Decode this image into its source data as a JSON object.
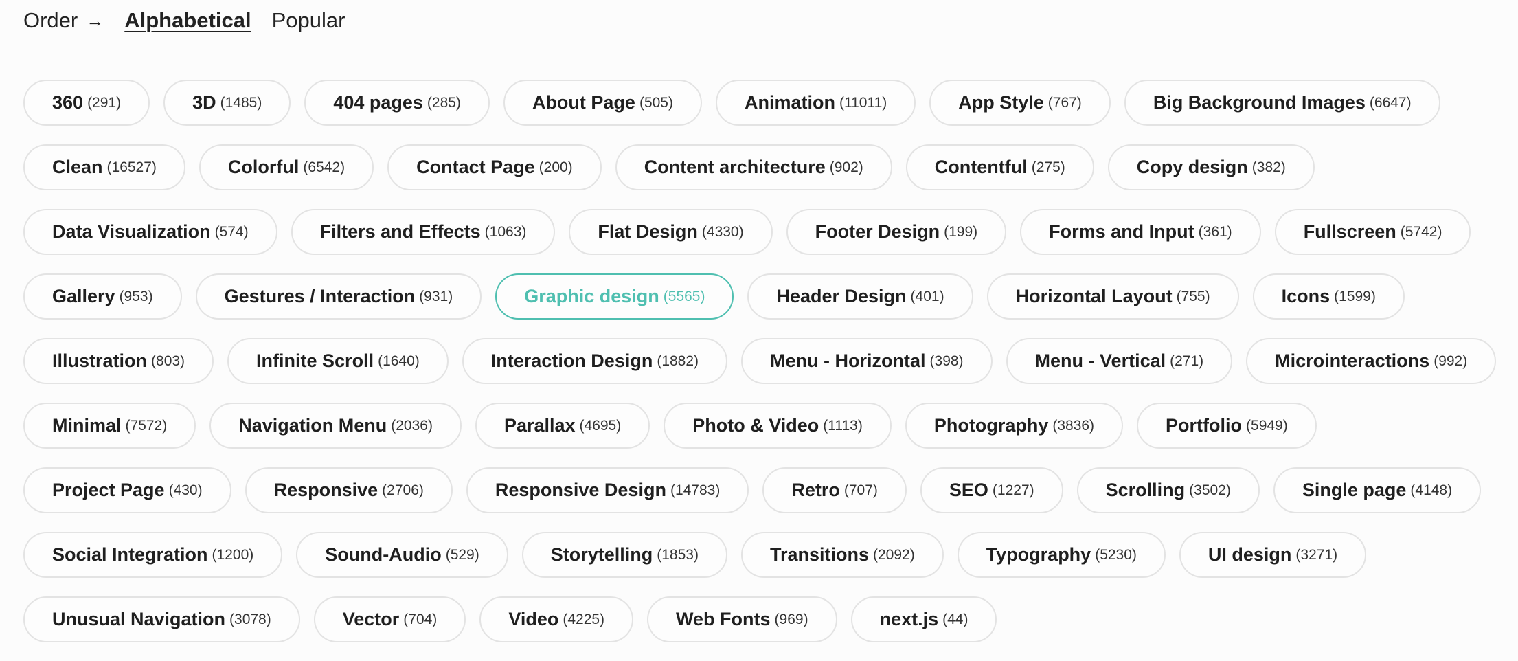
{
  "order": {
    "label": "Order",
    "arrow": "→",
    "options": [
      {
        "label": "Alphabetical",
        "active": true
      },
      {
        "label": "Popular",
        "active": false
      }
    ]
  },
  "accent_color": "#4fbfb0",
  "tags": [
    {
      "name": "360",
      "count": "(291)"
    },
    {
      "name": "3D",
      "count": "(1485)"
    },
    {
      "name": "404 pages",
      "count": "(285)"
    },
    {
      "name": "About Page",
      "count": "(505)"
    },
    {
      "name": "Animation",
      "count": "(11011)"
    },
    {
      "name": "App Style",
      "count": "(767)"
    },
    {
      "name": "Big Background Images",
      "count": "(6647)"
    },
    {
      "name": "Clean",
      "count": "(16527)"
    },
    {
      "name": "Colorful",
      "count": "(6542)"
    },
    {
      "name": "Contact Page",
      "count": "(200)"
    },
    {
      "name": "Content architecture",
      "count": "(902)"
    },
    {
      "name": "Contentful",
      "count": "(275)"
    },
    {
      "name": "Copy design",
      "count": "(382)"
    },
    {
      "name": "Data Visualization",
      "count": "(574)"
    },
    {
      "name": "Filters and Effects",
      "count": "(1063)"
    },
    {
      "name": "Flat Design",
      "count": "(4330)"
    },
    {
      "name": "Footer Design",
      "count": "(199)"
    },
    {
      "name": "Forms and Input",
      "count": "(361)"
    },
    {
      "name": "Fullscreen",
      "count": "(5742)"
    },
    {
      "name": "Gallery",
      "count": "(953)"
    },
    {
      "name": "Gestures / Interaction",
      "count": "(931)"
    },
    {
      "name": "Graphic design",
      "count": "(5565)",
      "selected": true
    },
    {
      "name": "Header Design",
      "count": "(401)"
    },
    {
      "name": "Horizontal Layout",
      "count": "(755)"
    },
    {
      "name": "Icons",
      "count": "(1599)"
    },
    {
      "name": "Illustration",
      "count": "(803)"
    },
    {
      "name": "Infinite Scroll",
      "count": "(1640)"
    },
    {
      "name": "Interaction Design",
      "count": "(1882)"
    },
    {
      "name": "Menu - Horizontal",
      "count": "(398)"
    },
    {
      "name": "Menu - Vertical",
      "count": "(271)"
    },
    {
      "name": "Microinteractions",
      "count": "(992)"
    },
    {
      "name": "Minimal",
      "count": "(7572)"
    },
    {
      "name": "Navigation Menu",
      "count": "(2036)"
    },
    {
      "name": "Parallax",
      "count": "(4695)"
    },
    {
      "name": "Photo & Video",
      "count": "(1113)"
    },
    {
      "name": "Photography",
      "count": "(3836)"
    },
    {
      "name": "Portfolio",
      "count": "(5949)"
    },
    {
      "name": "Project Page",
      "count": "(430)"
    },
    {
      "name": "Responsive",
      "count": "(2706)"
    },
    {
      "name": "Responsive Design",
      "count": "(14783)"
    },
    {
      "name": "Retro",
      "count": "(707)"
    },
    {
      "name": "SEO",
      "count": "(1227)"
    },
    {
      "name": "Scrolling",
      "count": "(3502)"
    },
    {
      "name": "Single page",
      "count": "(4148)"
    },
    {
      "name": "Social Integration",
      "count": "(1200)"
    },
    {
      "name": "Sound-Audio",
      "count": "(529)"
    },
    {
      "name": "Storytelling",
      "count": "(1853)"
    },
    {
      "name": "Transitions",
      "count": "(2092)"
    },
    {
      "name": "Typography",
      "count": "(5230)"
    },
    {
      "name": "UI design",
      "count": "(3271)"
    },
    {
      "name": "Unusual Navigation",
      "count": "(3078)"
    },
    {
      "name": "Vector",
      "count": "(704)"
    },
    {
      "name": "Video",
      "count": "(4225)"
    },
    {
      "name": "Web Fonts",
      "count": "(969)"
    },
    {
      "name": "next.js",
      "count": "(44)"
    }
  ]
}
